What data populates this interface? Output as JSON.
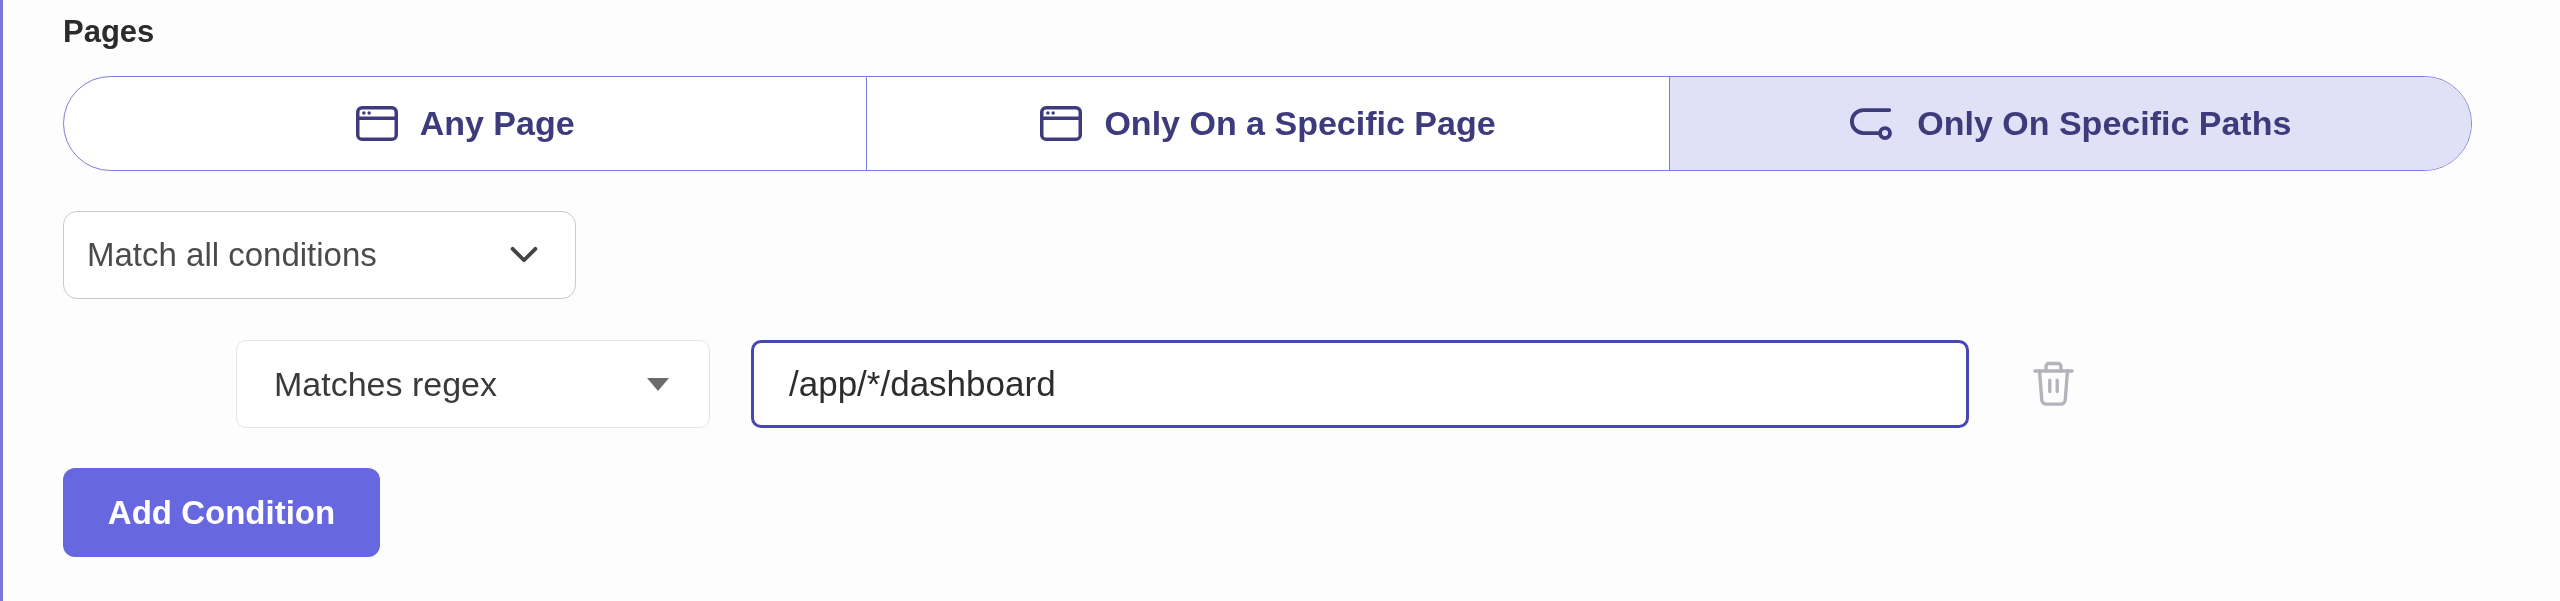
{
  "section": {
    "title": "Pages"
  },
  "page_scope_tabs": [
    {
      "label": "Any Page",
      "kind": "window",
      "selected": false
    },
    {
      "label": "Only On a Specific Page",
      "kind": "window",
      "selected": false
    },
    {
      "label": "Only On Specific Paths",
      "kind": "route",
      "selected": true
    }
  ],
  "match_select": {
    "value": "Match all conditions"
  },
  "conditions": [
    {
      "operator": "Matches regex",
      "value": "/app/*/dashboard",
      "focused": true
    }
  ],
  "add_button": {
    "label": "Add Condition"
  }
}
